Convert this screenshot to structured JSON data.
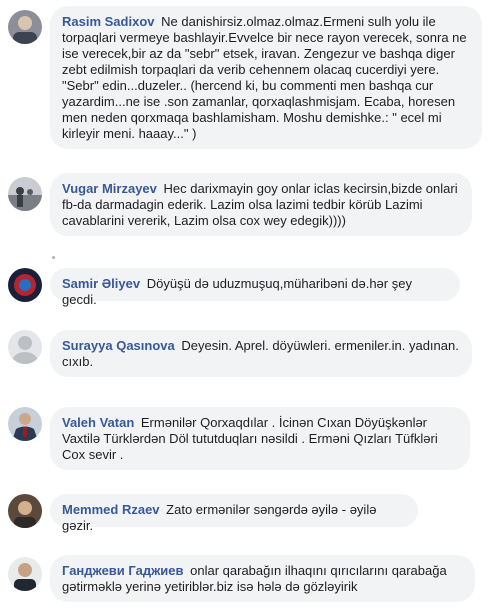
{
  "comments": [
    {
      "author": "Rasim Sadixov",
      "text": "Ne danishirsiz.olmaz.olmaz.Ermeni sulh yolu ile torpaqlari vermeye bashlayir.Evvelce bir nece rayon verecek, sonra ne ise verecek,bir az da \"sebr\" etsek, iravan. Zengezur ve bashqa diger zebt edilmish torpaqlari da verib cehennem olacaq cucerdiyi yere. \"Sebr\" edin...duzeler.. (hercend ki, bu commenti men bashqa cur yazardim...ne ise .son zamanlar, qorxaqlashmisjam. Ecaba, horesen men neden qorxmaqa bashlamisham. Moshu demishke.: \" ecel mi kirleyir meni. haaay...\" )"
    },
    {
      "author": "Vugar Mirzayev",
      "text": "Hec darixmayin goy onlar iclas kecirsin,bizde onlari fb-da darmadagin ederik. Lazim olsa lazimi tedbir körüb Lazimi cavablarini vererik, Lazim olsa cox wey edegik))))"
    },
    {
      "author": "Samir Əliyev",
      "text": "Döyüşü də uduzmuşuq,müharibəni də.hər şey gecdi."
    },
    {
      "author": "Surayya Qasınova",
      "text": "Deyesin. Aprel. döyüwleri. ermeniler.in. yadınan. cıxıb."
    },
    {
      "author": "Valeh Vatan",
      "text": "Ermənilər Qorxaqdılar . İcinən Cıxan Döyüşkənlər Vaxtilə Türklərdən Döl tututduqları nəsildi . Erməni Qızları Tüfkləri Cox sevir ."
    },
    {
      "author": "Memmed Rzaev",
      "text": "Zato ermənilər səngərdə əyilə - əyilə gəzir."
    },
    {
      "author": "Ганджеви Гаджиев",
      "text": "onlar qarabağın ilhaqını qırıcılarını qarabağa gətirməklə yerinə yetiriblər.biz isə hələ də gözləyirik"
    }
  ]
}
